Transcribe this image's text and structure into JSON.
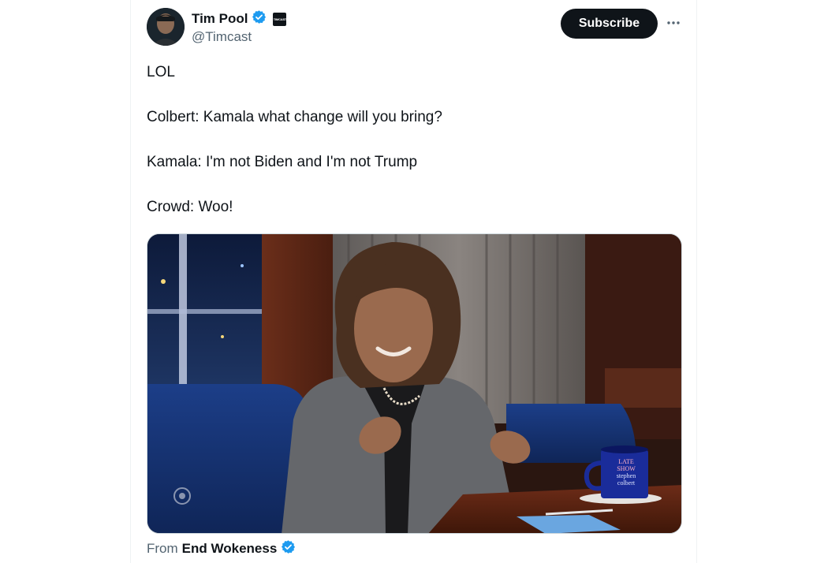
{
  "author": {
    "name": "Tim Pool",
    "handle": "@Timcast",
    "affiliate_badge": "TIMCAST",
    "verified_color": "#1d9bf0"
  },
  "actions": {
    "subscribe_label": "Subscribe",
    "more_icon": "more-horizontal-icon"
  },
  "tweet": {
    "lines": [
      "LOL",
      "Colbert: Kamala what change will you bring?",
      "Kamala: I'm not Biden and I'm not Trump",
      "Crowd: Woo!"
    ]
  },
  "media": {
    "mug_text": [
      "LATE",
      "SHOW",
      "stephen",
      "colbert"
    ],
    "network_icon": "cbs-eye-icon"
  },
  "source": {
    "prefix": "From",
    "account": "End Wokeness"
  },
  "colors": {
    "subscribe_bg": "#0f1419",
    "secondary_text": "#536471",
    "verified": "#1d9bf0"
  }
}
